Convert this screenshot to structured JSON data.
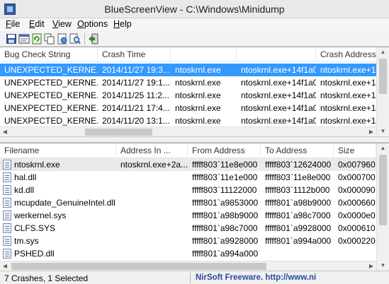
{
  "window": {
    "title": "BlueScreenView  -  C:\\Windows\\Minidump"
  },
  "menu": [
    {
      "label": "File",
      "hotkey": "F"
    },
    {
      "label": "Edit",
      "hotkey": "E"
    },
    {
      "label": "View",
      "hotkey": "V"
    },
    {
      "label": "Options",
      "hotkey": "O"
    },
    {
      "label": "Help",
      "hotkey": "H"
    }
  ],
  "toolbar": [
    {
      "icon": "save-icon"
    },
    {
      "icon": "properties-icon"
    },
    {
      "icon": "refresh-icon"
    },
    {
      "icon": "copy-icon"
    },
    {
      "icon": "html-report-icon"
    },
    {
      "icon": "find-icon"
    },
    {
      "icon": "exit-icon"
    }
  ],
  "crash_list": {
    "columns": [
      "Bug Check String",
      "Crash Time",
      "",
      "",
      "Crash Address"
    ],
    "rows": [
      {
        "bug_check": "UNEXPECTED_KERNE...",
        "time": "2014/11/27 19:3...",
        "driver": "ntoskrnl.exe",
        "caused_by": "ntoskrnl.exe+14f1a0",
        "address": "ntoskrnl.exe+14",
        "selected": true
      },
      {
        "bug_check": "UNEXPECTED_KERNE...",
        "time": "2014/11/27 19:1...",
        "driver": "ntoskrnl.exe",
        "caused_by": "ntoskrnl.exe+14f1a0",
        "address": "ntoskrnl.exe+14",
        "selected": false
      },
      {
        "bug_check": "UNEXPECTED_KERNE...",
        "time": "2014/11/25 11:2...",
        "driver": "ntoskrnl.exe",
        "caused_by": "ntoskrnl.exe+14f1a0",
        "address": "ntoskrnl.exe+14",
        "selected": false
      },
      {
        "bug_check": "UNEXPECTED_KERNE...",
        "time": "2014/11/21 17:4...",
        "driver": "ntoskrnl.exe",
        "caused_by": "ntoskrnl.exe+14f1a0",
        "address": "ntoskrnl.exe+14",
        "selected": false
      },
      {
        "bug_check": "UNEXPECTED_KERNE...",
        "time": "2014/11/20 13:1...",
        "driver": "ntoskrnl.exe",
        "caused_by": "ntoskrnl.exe+14f1a0",
        "address": "ntoskrnl.exe+14",
        "selected": false
      }
    ]
  },
  "driver_list": {
    "columns": [
      "Filename",
      "Address In ...",
      "From Address",
      "To Address",
      "Size"
    ],
    "rows": [
      {
        "file": "ntoskrnl.exe",
        "address_in": "ntoskrnl.exe+2a...",
        "from": "fffff803`11e8e000",
        "to": "fffff803`12624000",
        "size": "0x007960"
      },
      {
        "file": "hal.dll",
        "address_in": "",
        "from": "fffff803`11e1e000",
        "to": "fffff803`11e8e000",
        "size": "0x000700"
      },
      {
        "file": "kd.dll",
        "address_in": "",
        "from": "fffff803`11122000",
        "to": "fffff803`1112b000",
        "size": "0x000090"
      },
      {
        "file": "mcupdate_GenuineIntel.dll",
        "address_in": "",
        "from": "fffff801`a9853000",
        "to": "fffff801`a98b9000",
        "size": "0x000660"
      },
      {
        "file": "werkernel.sys",
        "address_in": "",
        "from": "fffff801`a98b9000",
        "to": "fffff801`a98c7000",
        "size": "0x0000e0"
      },
      {
        "file": "CLFS.SYS",
        "address_in": "",
        "from": "fffff801`a98c7000",
        "to": "fffff801`a9928000",
        "size": "0x000610"
      },
      {
        "file": "tm.sys",
        "address_in": "",
        "from": "fffff801`a9928000",
        "to": "fffff801`a994a000",
        "size": "0x000220"
      },
      {
        "file": "PSHED.dll",
        "address_in": "",
        "from": "fffff801`a994a000",
        "to": "",
        "size": ""
      }
    ]
  },
  "status": {
    "summary": "7 Crashes, 1 Selected",
    "link": "NirSoft Freeware.  http://www.ni"
  },
  "colors": {
    "selection": "#3399ff",
    "link": "#2a4c9c"
  }
}
